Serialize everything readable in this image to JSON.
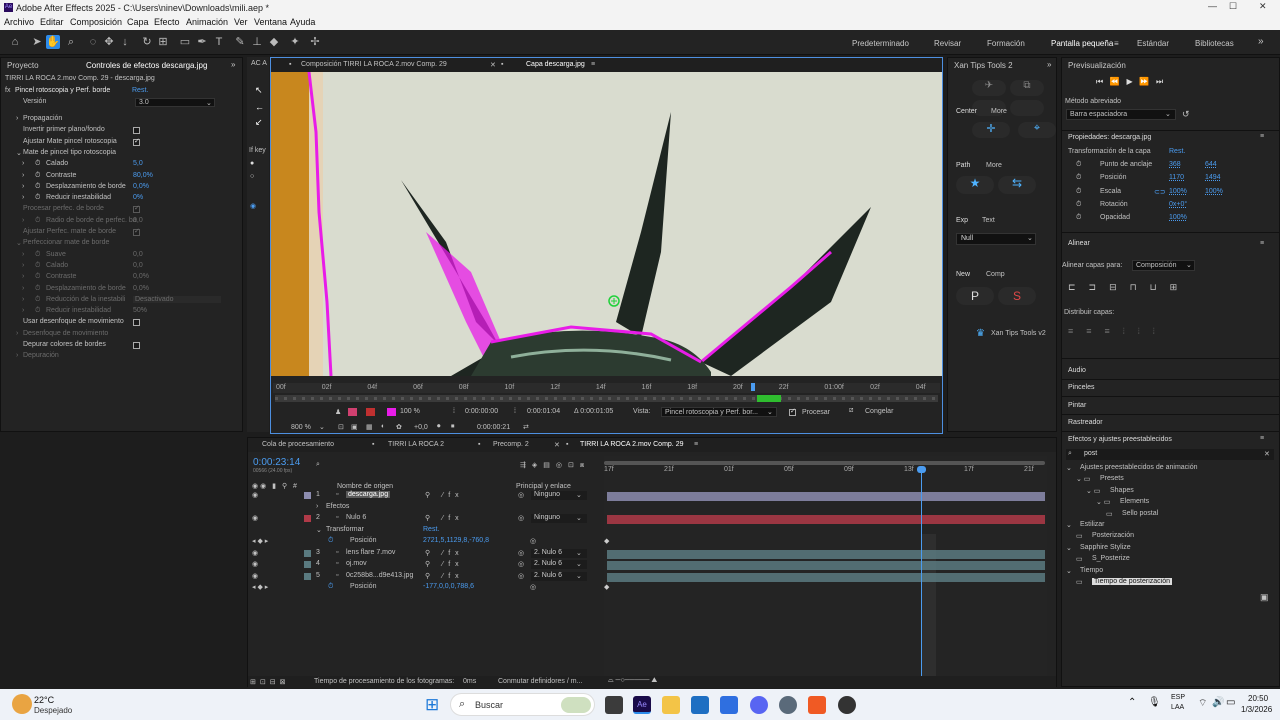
{
  "window": {
    "title": "Adobe After Effects 2025 - C:\\Users\\ninev\\Downloads\\mili.aep *"
  },
  "menu": [
    "Archivo",
    "Editar",
    "Composición",
    "Capa",
    "Efecto",
    "Animación",
    "Ver",
    "Ventana",
    "Ayuda"
  ],
  "workspaces": [
    "Predeterminado",
    "Revisar",
    "Formación",
    "Pantalla pequeña",
    "Estándar",
    "Bibliotecas"
  ],
  "project_panel": {
    "tab1": "Proyecto",
    "tab2": "Controles de efectos descarga.jpg",
    "header": "TIRRI LA ROCA 2.mov Comp. 29 - descarga.jpg",
    "effect": "Pincel rotoscopia y Perf. borde",
    "reset": "Rest.",
    "version_label": "Versión",
    "version_value": "3.0",
    "rows": [
      {
        "label": "Propagación",
        "indent": 1,
        "arrow": "›"
      },
      {
        "label": "Invertir primer plano/fondo",
        "indent": 1,
        "cb": "off"
      },
      {
        "label": "Ajustar Mate pincel rotoscopia",
        "indent": 1,
        "cb": "on"
      },
      {
        "label": "Mate de pincel tipo rotoscopia",
        "indent": 1,
        "arrow": "⌄"
      },
      {
        "label": "Calado",
        "indent": 2,
        "arrow": "›",
        "val": "5,0",
        "blue": true
      },
      {
        "label": "Contraste",
        "indent": 2,
        "arrow": "›",
        "val": "80,0%",
        "blue": true
      },
      {
        "label": "Desplazamiento de borde",
        "indent": 2,
        "arrow": "›",
        "val": "0,0%",
        "blue": true
      },
      {
        "label": "Reducir inestabilidad",
        "indent": 2,
        "arrow": "›",
        "val": "0%",
        "blue": true
      },
      {
        "label": "Procesar perfec. de borde",
        "indent": 1,
        "cb": "dim",
        "dim": true
      },
      {
        "label": "Radio de borde de perfec. ba",
        "indent": 2,
        "arrow": "›",
        "val": "0,0",
        "dim": true
      },
      {
        "label": "Ajustar Perfec. mate de borde",
        "indent": 1,
        "cb": "dim",
        "dim": true
      },
      {
        "label": "Perfeccionar mate de borde",
        "indent": 1,
        "arrow": "⌄",
        "dim": true
      },
      {
        "label": "Suave",
        "indent": 2,
        "arrow": "›",
        "val": "0,0",
        "dim": true
      },
      {
        "label": "Calado",
        "indent": 2,
        "arrow": "›",
        "val": "0,0",
        "dim": true
      },
      {
        "label": "Contraste",
        "indent": 2,
        "arrow": "›",
        "val": "0,0%",
        "dim": true
      },
      {
        "label": "Desplazamiento de borde",
        "indent": 2,
        "arrow": "›",
        "val": "0,0%",
        "dim": true
      },
      {
        "label": "Reducción de la inestabili",
        "indent": 2,
        "arrow": "›",
        "val": "Desactivado",
        "dim": true
      },
      {
        "label": "Reducir inestabilidad",
        "indent": 2,
        "arrow": "›",
        "val": "50%",
        "dim": true
      },
      {
        "label": "Usar desenfoque de movimiento",
        "indent": 1,
        "cb": "off"
      },
      {
        "label": "Desenfoque de movimiento",
        "indent": 1,
        "arrow": "›",
        "dim": true
      },
      {
        "label": "Depurar colores de bordes",
        "indent": 1,
        "cb": "off"
      },
      {
        "label": "Depuración",
        "indent": 1,
        "arrow": "›",
        "dim": true
      }
    ]
  },
  "viewer": {
    "tab_ac": "AC A",
    "tab1": "Composición TIRRI LA ROCA 2.mov Comp. 29",
    "tab2": "Capa descarga.jpg",
    "ruler": [
      "00f",
      "02f",
      "04f",
      "06f",
      "08f",
      "10f",
      "12f",
      "14f",
      "16f",
      "18f",
      "20f",
      "22f",
      "01:00f",
      "02f",
      "04f"
    ],
    "zoom": "100 %",
    "t1": "0:00:00:00",
    "t2": "0:00:01:04",
    "t3": "Δ 0:00:01:05",
    "vista_label": "Vista:",
    "vista_value": "Pincel rotoscopia y Perf. bor...",
    "procesar": "Procesar",
    "congelar": "Congelar",
    "zoom2": "800 %",
    "offset": "+0,0",
    "time": "0:00:00:21",
    "side_text": "If key"
  },
  "right_mid": {
    "title": "Xan Tips Tools 2",
    "center": "Center",
    "more": "More",
    "path": "Path",
    "more2": "More",
    "exp": "Exp",
    "text": "Text",
    "null_value": "Null",
    "new": "New",
    "comp": "Comp",
    "p": "P",
    "s": "S",
    "brand": "Xan Tips Tools v2"
  },
  "preview": {
    "title": "Previsualización",
    "method_label": "Método abreviado",
    "method_value": "Barra espaciadora"
  },
  "props": {
    "title": "Propiedades: descarga.jpg",
    "section": "Transformación de la capa",
    "reset": "Rest.",
    "rows": [
      {
        "label": "Punto de anclaje",
        "v1": "368",
        "v2": "644"
      },
      {
        "label": "Posición",
        "v1": "1170",
        "v2": "1494"
      },
      {
        "label": "Escala",
        "v1": "100%",
        "v2": "100%"
      },
      {
        "label": "Rotación",
        "v1": "0x+0°",
        "v2": ""
      },
      {
        "label": "Opacidad",
        "v1": "100%",
        "v2": ""
      }
    ]
  },
  "align": {
    "title": "Alinear",
    "align_to": "Alinear capas para:",
    "align_value": "Composición",
    "distribute": "Distribuir capas:"
  },
  "collapsed": [
    "Audio",
    "Pinceles",
    "Pintar",
    "Rastreador"
  ],
  "effects_panel": {
    "title": "Efectos y ajustes preestablecidos",
    "search": "post",
    "tree": [
      {
        "t": "Ajustes preestablecidos de animación",
        "lvl": 0
      },
      {
        "t": "Presets",
        "lvl": 1
      },
      {
        "t": "Shapes",
        "lvl": 2
      },
      {
        "t": "Elements",
        "lvl": 3
      },
      {
        "t": "Sello postal",
        "lvl": 4
      },
      {
        "t": "Estilizar",
        "lvl": 0
      },
      {
        "t": "Posterización",
        "lvl": 1
      },
      {
        "t": "Sapphire Stylize",
        "lvl": 0
      },
      {
        "t": "S_Posterize",
        "lvl": 1
      },
      {
        "t": "Tiempo",
        "lvl": 0
      },
      {
        "t": "Tiempo de posterización",
        "lvl": 1
      }
    ]
  },
  "timeline": {
    "tabs": [
      "Cola de procesamiento",
      "TIRRI LA ROCA 2",
      "Precomp. 2",
      "TIRRI LA ROCA 2.mov Comp. 29"
    ],
    "timecode": "0:00:23:14",
    "fps": "00566 (24.00 fps)",
    "col_name": "Nombre de origen",
    "col_parent": "Principal y enlace",
    "ruler": [
      "17f",
      "21f",
      "01f",
      "05f",
      "09f",
      "13f",
      "17f",
      "21f"
    ],
    "layers": [
      {
        "num": "1",
        "name": "descarga.jpg",
        "parent": "Ninguno",
        "color": "#8d8db0"
      },
      {
        "sub": "Efectos"
      },
      {
        "num": "2",
        "name": "Nulo 6",
        "parent": "Ninguno",
        "color": "#b03a48"
      },
      {
        "sub": "Transformar",
        "val": "Rest."
      },
      {
        "prop": "Posición",
        "val": "2721,5,1129,8,-760,8"
      },
      {
        "num": "3",
        "name": "lens flare 7.mov",
        "parent": "2. Nulo 6",
        "color": "#5a7a80"
      },
      {
        "num": "4",
        "name": "oj.mov",
        "parent": "2. Nulo 6",
        "color": "#5a7a80"
      },
      {
        "num": "5",
        "name": "0c258b8...d9e413.jpg",
        "parent": "2. Nulo 6",
        "color": "#5a7a80"
      },
      {
        "prop": "Posición",
        "val": "-177,0,0,0,788,6"
      }
    ],
    "status_left": "Tiempo de procesamiento de los fotogramas:",
    "status_ms": "0ms",
    "status_right": "Conmutar definidores / m..."
  },
  "taskbar": {
    "temp": "22°C",
    "weather": "Despejado",
    "search": "Buscar",
    "lang1": "ESP",
    "lang2": "LAA",
    "time": "20:50",
    "date": "1/3/2026"
  }
}
